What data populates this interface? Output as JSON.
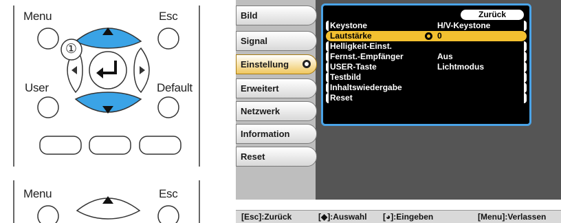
{
  "remote": {
    "top_labels": {
      "menu": "Menu",
      "esc": "Esc",
      "user": "User",
      "default": "Default"
    },
    "bottom_labels": {
      "menu": "Menu",
      "esc": "Esc"
    },
    "step_marker": "①"
  },
  "osd": {
    "tabs": [
      {
        "label": "Bild",
        "active": false
      },
      {
        "label": "Signal",
        "active": false
      },
      {
        "label": "Einstellung",
        "active": true
      },
      {
        "label": "Erweitert",
        "active": false
      },
      {
        "label": "Netzwerk",
        "active": false
      },
      {
        "label": "Information",
        "active": false
      },
      {
        "label": "Reset",
        "active": false
      }
    ],
    "back_button": "Zurück",
    "items": [
      {
        "label": "Keystone",
        "value": "H/V-Keystone",
        "selected": false
      },
      {
        "label": "Lautstärke",
        "value": "0",
        "selected": true
      },
      {
        "label": "Helligkeit-Einst.",
        "value": "",
        "selected": false
      },
      {
        "label": "Fernst.-Empfänger",
        "value": "Aus",
        "selected": false
      },
      {
        "label": "USER-Taste",
        "value": "Lichtmodus",
        "selected": false
      },
      {
        "label": "Testbild",
        "value": "",
        "selected": false
      },
      {
        "label": "Inhaltswiedergabe",
        "value": "",
        "selected": false
      },
      {
        "label": "Reset",
        "value": "",
        "selected": false
      }
    ],
    "status": {
      "back": "[Esc]:Zurück",
      "select": "[◆]:Auswahl",
      "enter": "[◕]:Eingeben",
      "quit": "[Menu]:Verlassen"
    },
    "colors": {
      "highlight": "#f3c030",
      "frame": "#4aa4e8",
      "panel": "#555555"
    }
  }
}
